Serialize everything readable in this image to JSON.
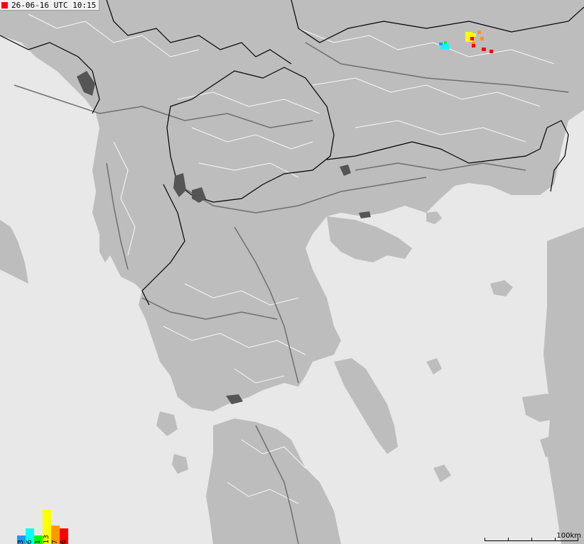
{
  "header": {
    "timestamp": "26-06-16 UTC 10:15",
    "marker_color": "#ff0000"
  },
  "map": {
    "sea_color": "#e8e8e8",
    "land_color": "#bdbdbd",
    "lake_color": "#555555",
    "border_color": "#000000",
    "region_border_color": "#ffffff",
    "road_color": "#6e6e6e"
  },
  "legend": {
    "bars": [
      {
        "label": "3",
        "color": "#2196f3",
        "fraction": 0.23
      },
      {
        "label": "6",
        "color": "#00ffff",
        "fraction": 0.46
      },
      {
        "label": "1",
        "color": "#00ff00",
        "fraction": 0.08
      },
      {
        "label": "13",
        "color": "#ffff00",
        "fraction": 1.0
      },
      {
        "label": "7",
        "color": "#ff9900",
        "fraction": 0.54
      },
      {
        "label": "6",
        "color": "#ff0000",
        "fraction": 0.46
      }
    ]
  },
  "strikes": [
    {
      "color": "#ffff00",
      "count": 13
    },
    {
      "color": "#ff9900",
      "count": 7
    },
    {
      "color": "#ff0000",
      "count": 6
    },
    {
      "color": "#00ffff",
      "count": 6
    },
    {
      "color": "#2196f3",
      "count": 3
    },
    {
      "color": "#00ff00",
      "count": 1
    }
  ],
  "scale": {
    "label": "100km"
  }
}
